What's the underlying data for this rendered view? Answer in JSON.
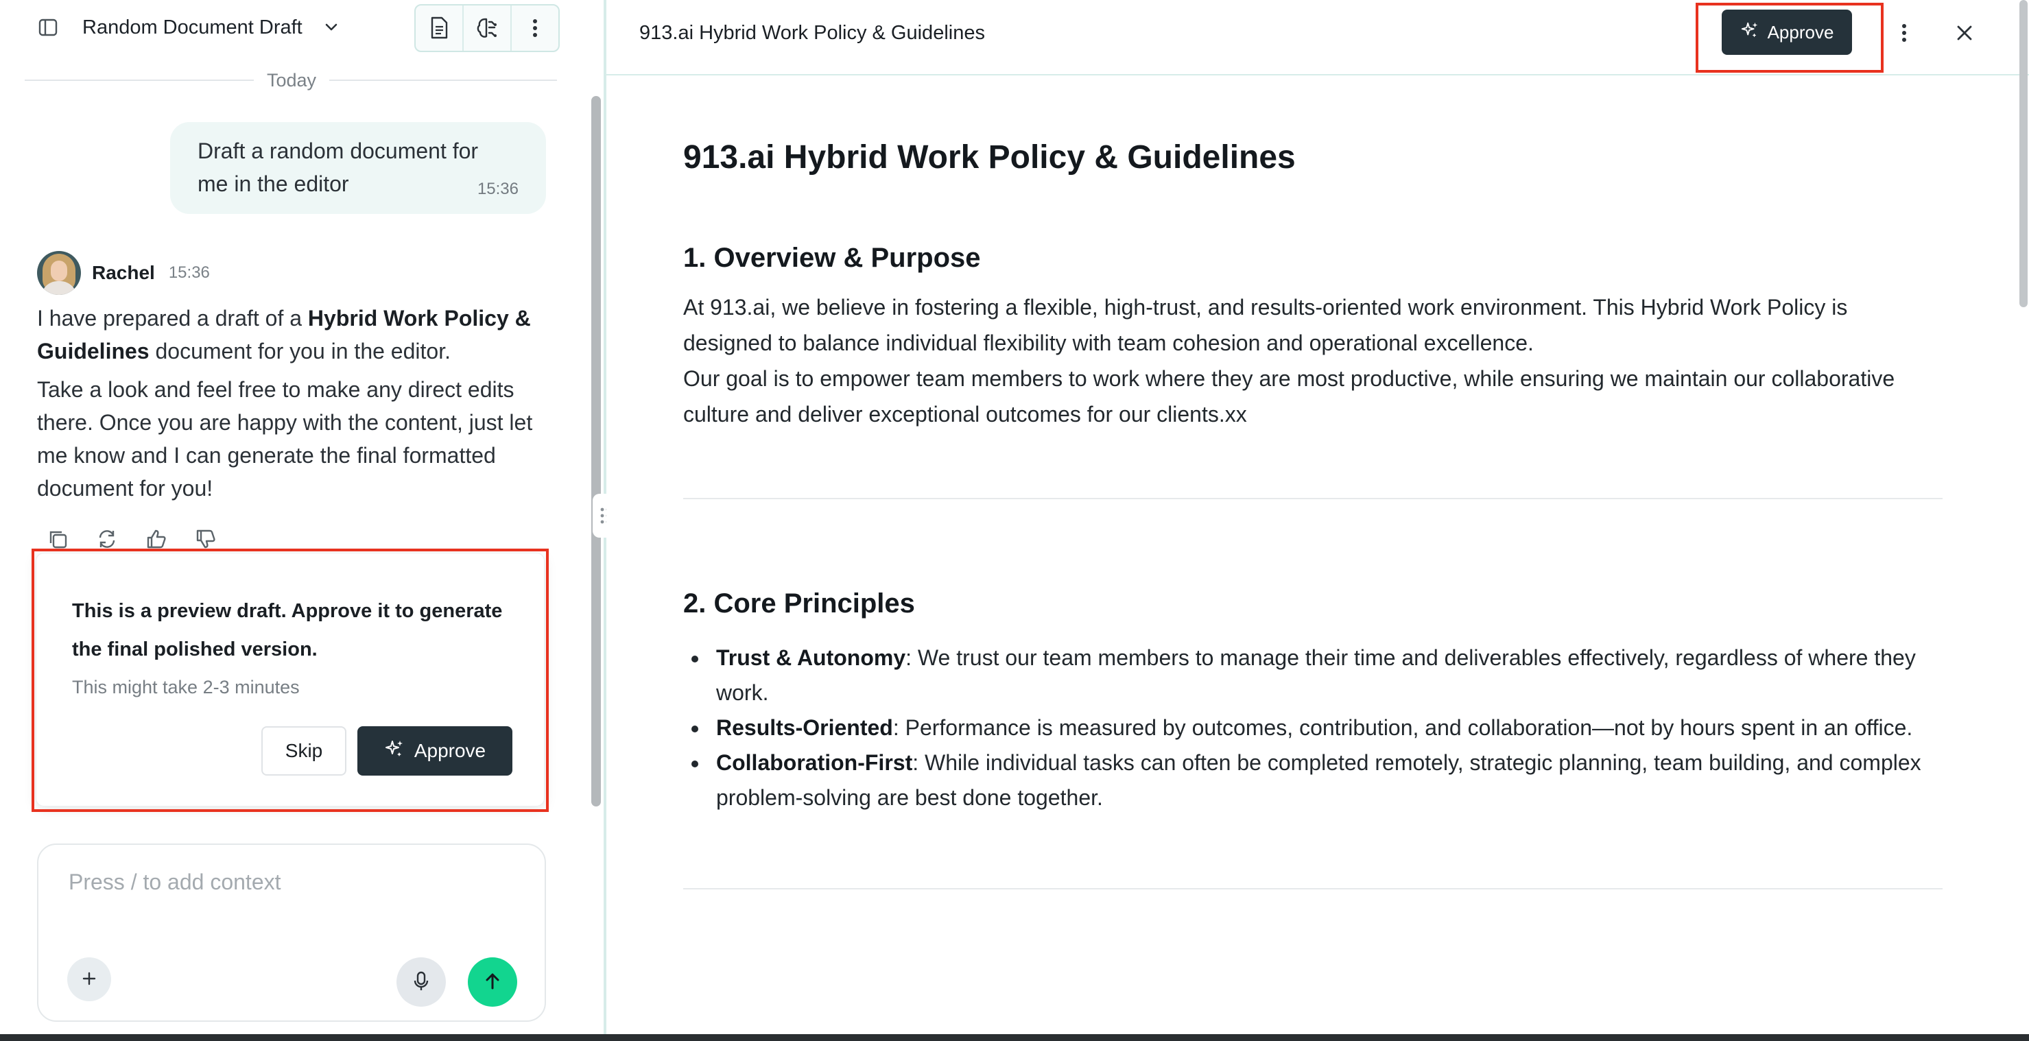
{
  "chat": {
    "header": {
      "title": "Random Document Draft"
    },
    "date_divider": "Today",
    "user_message": {
      "text": "Draft a random document for me in the editor",
      "time": "15:36"
    },
    "assistant": {
      "name": "Rachel",
      "time": "15:36",
      "para1_prefix": "I have prepared a draft of a ",
      "para1_bold": "Hybrid Work Policy & Guidelines",
      "para1_suffix": " document for you in the editor.",
      "para2": "Take a look and feel free to make any direct edits there. Once you are happy with the content, just let me know and I can generate the final formatted document for you!"
    },
    "preview_card": {
      "heading": "This is a preview draft. Approve it to generate the final polished version.",
      "subtext": "This might take 2-3 minutes",
      "skip_label": "Skip",
      "approve_label": "Approve"
    },
    "composer": {
      "placeholder": "Press / to add context"
    }
  },
  "editor": {
    "title": "913.ai Hybrid Work Policy & Guidelines",
    "approve_label": "Approve",
    "document": {
      "h1": "913.ai Hybrid Work Policy & Guidelines",
      "section1": {
        "heading": "1. Overview & Purpose",
        "p1": "At 913.ai, we believe in fostering a flexible, high-trust, and results-oriented work environment. This Hybrid Work Policy is designed to balance individual flexibility with team cohesion and operational excellence.",
        "p2": "Our goal is to empower team members to work where they are most productive, while ensuring we maintain our collaborative culture and deliver exceptional outcomes for our clients.xx"
      },
      "section2": {
        "heading": "2. Core Principles",
        "items": [
          {
            "term": "Trust & Autonomy",
            "text": ": We trust our team members to manage their time and deliverables effectively, regardless of where they work."
          },
          {
            "term": "Results-Oriented",
            "text": ": Performance is measured by outcomes, contribution, and collaboration—not by hours spent in an office."
          },
          {
            "term": "Collaboration-First",
            "text": ": While individual tasks can often be completed remotely, strategic planning, team building, and complex problem-solving are best done together."
          }
        ]
      }
    }
  },
  "colors": {
    "accent_dark": "#25323a",
    "send_green": "#12d58f",
    "highlight_red": "#e8321f",
    "panel_border": "#d7ece9"
  },
  "icons": [
    "sidebar-toggle-icon",
    "chevron-down-icon",
    "document-icon",
    "brain-icon",
    "more-vertical-icon",
    "copy-icon",
    "refresh-icon",
    "thumbs-up-icon",
    "thumbs-down-icon",
    "sparkle-icon",
    "plus-icon",
    "microphone-icon",
    "arrow-up-icon",
    "drag-handle-icon",
    "close-icon"
  ]
}
